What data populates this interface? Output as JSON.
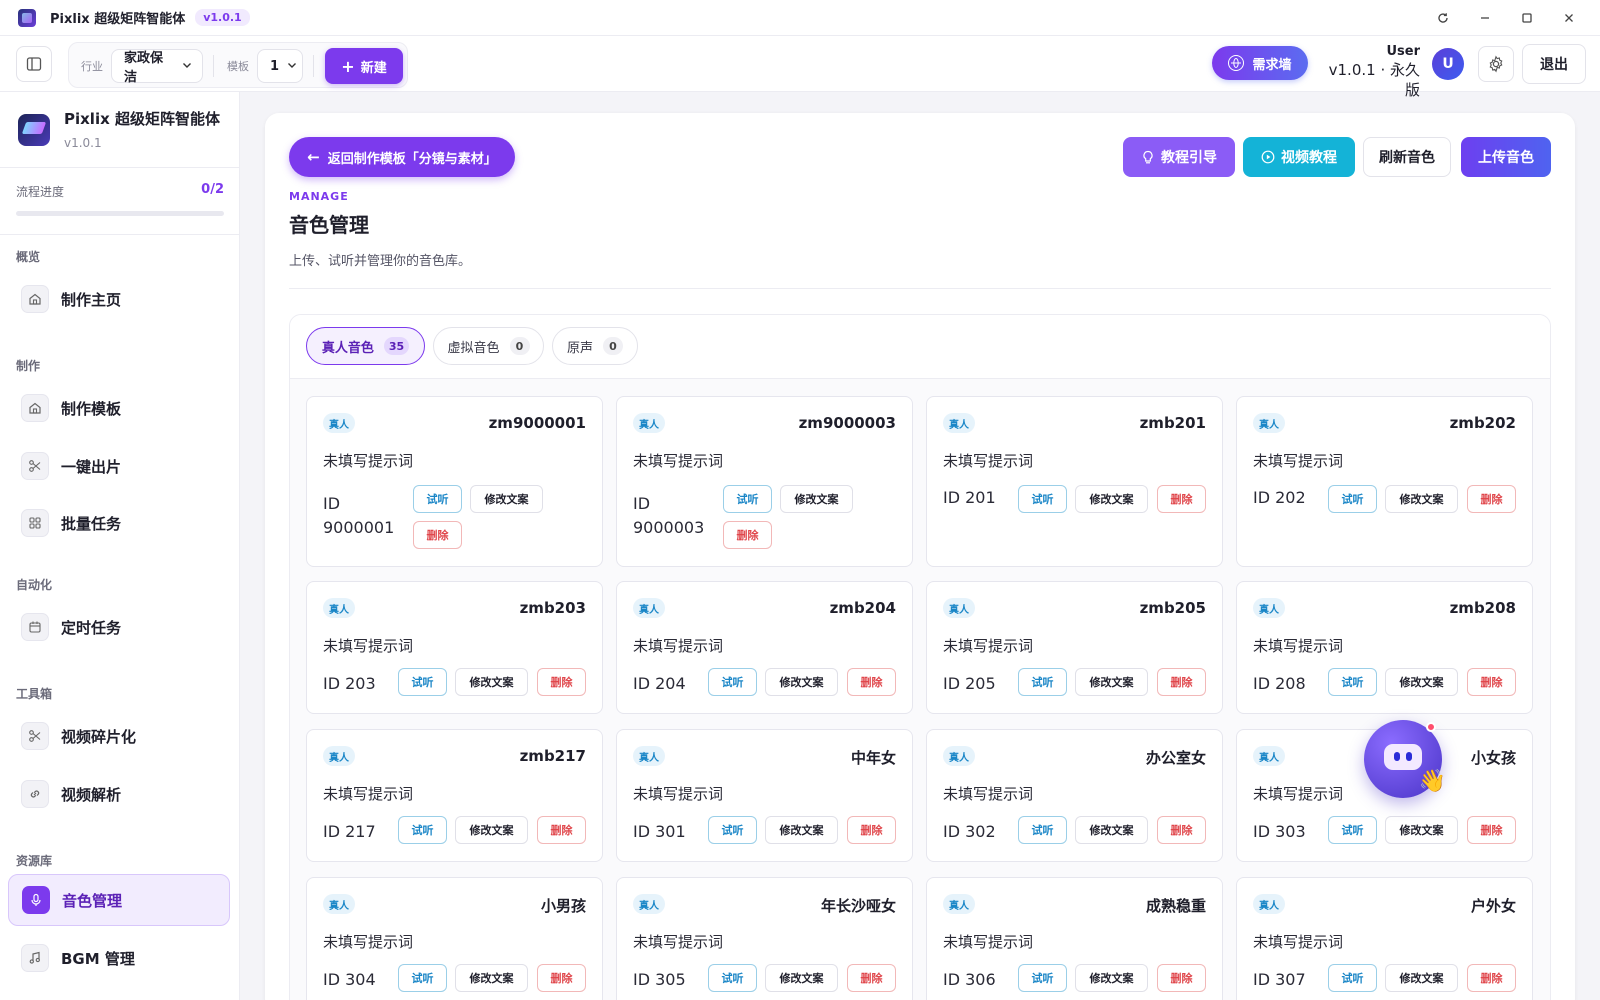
{
  "titlebar": {
    "app_name": "Pixlix 超级矩阵智能体",
    "version_badge": "v1.0.1",
    "controls": [
      "refresh-icon",
      "minimize-icon",
      "maximize-icon",
      "close-icon"
    ]
  },
  "toolbar": {
    "industry_label": "行业",
    "industry_value": "家政保洁",
    "template_label": "模板",
    "template_value": "1",
    "new_button": "新建",
    "needs_button": "需求墙",
    "user_name": "User",
    "user_version": "v1.0.1 · 永久版",
    "avatar_letter": "U",
    "logout_button": "退出"
  },
  "sidebar": {
    "app_title": "Pixlix 超级矩阵智能体",
    "app_version": "v1.0.1",
    "progress_label": "流程进度",
    "progress_value": "0/2",
    "progress_fraction": 0.0,
    "sections": {
      "overview": "概览",
      "produce": "制作",
      "automation": "自动化",
      "toolbox": "工具箱",
      "library": "资源库"
    },
    "items": {
      "home": "制作主页",
      "template": "制作模板",
      "one_click": "一键出片",
      "batch": "批量任务",
      "scheduled": "定时任务",
      "fragment": "视频碎片化",
      "parse": "视频解析",
      "voice": "音色管理",
      "bgm": "BGM 管理"
    },
    "active_item": "voice"
  },
  "main": {
    "back_button": "返回制作模板「分镜与素材」",
    "guide_button": "教程引导",
    "video_button": "视频教程",
    "refresh_button": "刷新音色",
    "upload_button": "上传音色",
    "section_tag": "MANAGE",
    "title": "音色管理",
    "description": "上传、试听并管理你的音色库。",
    "tabs": [
      {
        "label": "真人音色",
        "count": "35",
        "active": true
      },
      {
        "label": "虚拟音色",
        "count": "0",
        "active": false
      },
      {
        "label": "原声",
        "count": "0",
        "active": false
      }
    ],
    "card_labels": {
      "tag": "真人",
      "prompt": "未填写提示词",
      "listen": "试听",
      "edit": "修改文案",
      "delete": "删除"
    },
    "cards": [
      {
        "name": "zm9000001",
        "id": "ID 9000001"
      },
      {
        "name": "zm9000003",
        "id": "ID 9000003"
      },
      {
        "name": "zmb201",
        "id": "ID 201"
      },
      {
        "name": "zmb202",
        "id": "ID 202"
      },
      {
        "name": "zmb203",
        "id": "ID 203"
      },
      {
        "name": "zmb204",
        "id": "ID 204"
      },
      {
        "name": "zmb205",
        "id": "ID 205"
      },
      {
        "name": "zmb208",
        "id": "ID 208"
      },
      {
        "name": "zmb217",
        "id": "ID 217"
      },
      {
        "name": "中年女",
        "id": "ID 301"
      },
      {
        "name": "办公室女",
        "id": "ID 302"
      },
      {
        "name": "小女孩",
        "id": "ID 303"
      },
      {
        "name": "小男孩",
        "id": "ID 304"
      },
      {
        "name": "年长沙哑女",
        "id": "ID 305"
      },
      {
        "name": "成熟稳重",
        "id": "ID 306"
      },
      {
        "name": "户外女",
        "id": "ID 307"
      }
    ]
  },
  "colors": {
    "accent": "#7c3aed",
    "listen": "#1a86c7",
    "delete": "#e0474c",
    "video": "#14b3d7"
  }
}
